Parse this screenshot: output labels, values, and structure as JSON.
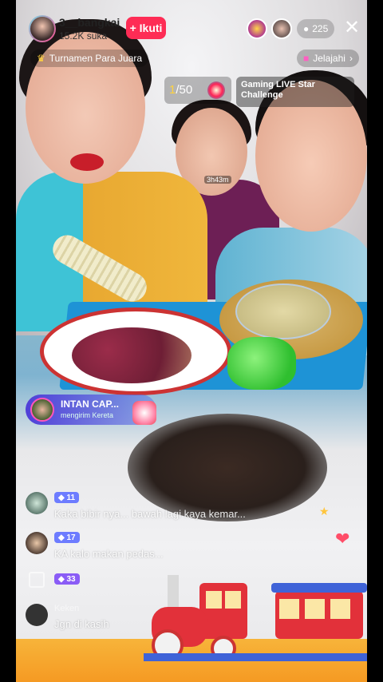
{
  "host": {
    "username": "3__bangkai",
    "likes": "15.2K suka",
    "follow_label": "Ikuti"
  },
  "viewers": {
    "count": "225"
  },
  "chips": {
    "tournament": "Turnamen Para Juara",
    "explore": "Jelajahi"
  },
  "rank": {
    "current": "1",
    "total": "/50",
    "timer": "3h43m"
  },
  "challenge": {
    "title": "Gaming LIVE Star Challenge"
  },
  "gift_banner": {
    "name": "INTAN CAP...",
    "subtitle": "mengirim Kereta"
  },
  "comments": [
    {
      "badge": "11",
      "badge_color": "#6d7cff",
      "name": "",
      "text": "Kaka bibir nya... bawah lagi kaya kemar..."
    },
    {
      "badge": "17",
      "badge_color": "#6d7cff",
      "name": "",
      "text": "KA kalo makan pedas..."
    },
    {
      "badge": "33",
      "badge_color": "#8a5cf6",
      "name": "",
      "text": ""
    },
    {
      "badge": "",
      "badge_color": "",
      "name": "Keken",
      "text": "Jgn di kasih"
    }
  ],
  "colors": {
    "follow": "#fe2c55",
    "accent": "#ffd23f",
    "heart": "#ff4d68"
  },
  "icons": {
    "close": "close-icon",
    "viewer": "person-icon",
    "tournament": "crown-icon",
    "explore": "chevron-right-icon"
  }
}
